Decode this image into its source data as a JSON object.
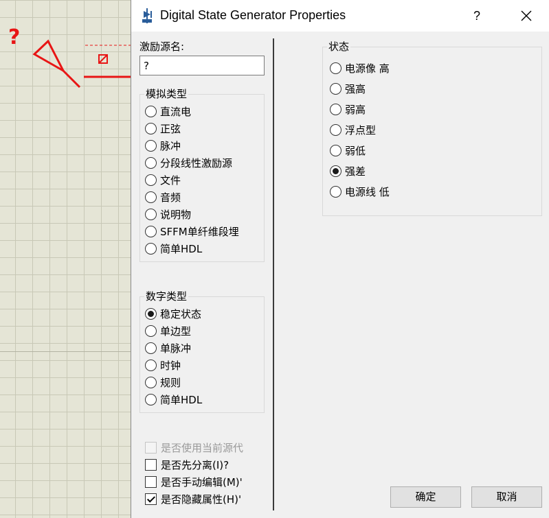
{
  "canvas": {
    "marker": "?"
  },
  "dialog": {
    "title": "Digital State Generator Properties",
    "icon": "generator-icon",
    "help_label": "?",
    "name_label": "激励源名:",
    "name_value": "?",
    "analog_group": {
      "title": "模拟类型",
      "options": [
        "直流电",
        "正弦",
        "脉冲",
        "分段线性激励源",
        "文件",
        "音频",
        "说明物",
        "SFFM单纤维段埋",
        "简单HDL"
      ],
      "selected": null
    },
    "digital_group": {
      "title": "数字类型",
      "options": [
        "稳定状态",
        "单边型",
        "单脉冲",
        "时钟",
        "规则",
        "简单HDL"
      ],
      "selected": 0
    },
    "checkboxes": [
      {
        "label": "是否使用当前源代",
        "checked": false,
        "disabled": true
      },
      {
        "label": "是否先分离(I)?",
        "checked": false,
        "disabled": false
      },
      {
        "label": "是否手动编辑(M)'",
        "checked": false,
        "disabled": false
      },
      {
        "label": "是否隐藏属性(H)'",
        "checked": true,
        "disabled": false
      }
    ],
    "state_group": {
      "title": "状态",
      "options": [
        "电源像 高",
        "强高",
        "弱高",
        "浮点型",
        "弱低",
        "强差",
        "电源线 低"
      ],
      "selected": 5
    },
    "ok_label": "确定",
    "cancel_label": "取消"
  },
  "colors": {
    "canvas_bg": "#e5e5d6",
    "grid": "#c8c8b6",
    "component_red": "#e81515",
    "dialog_bg": "#f0f0f0"
  }
}
